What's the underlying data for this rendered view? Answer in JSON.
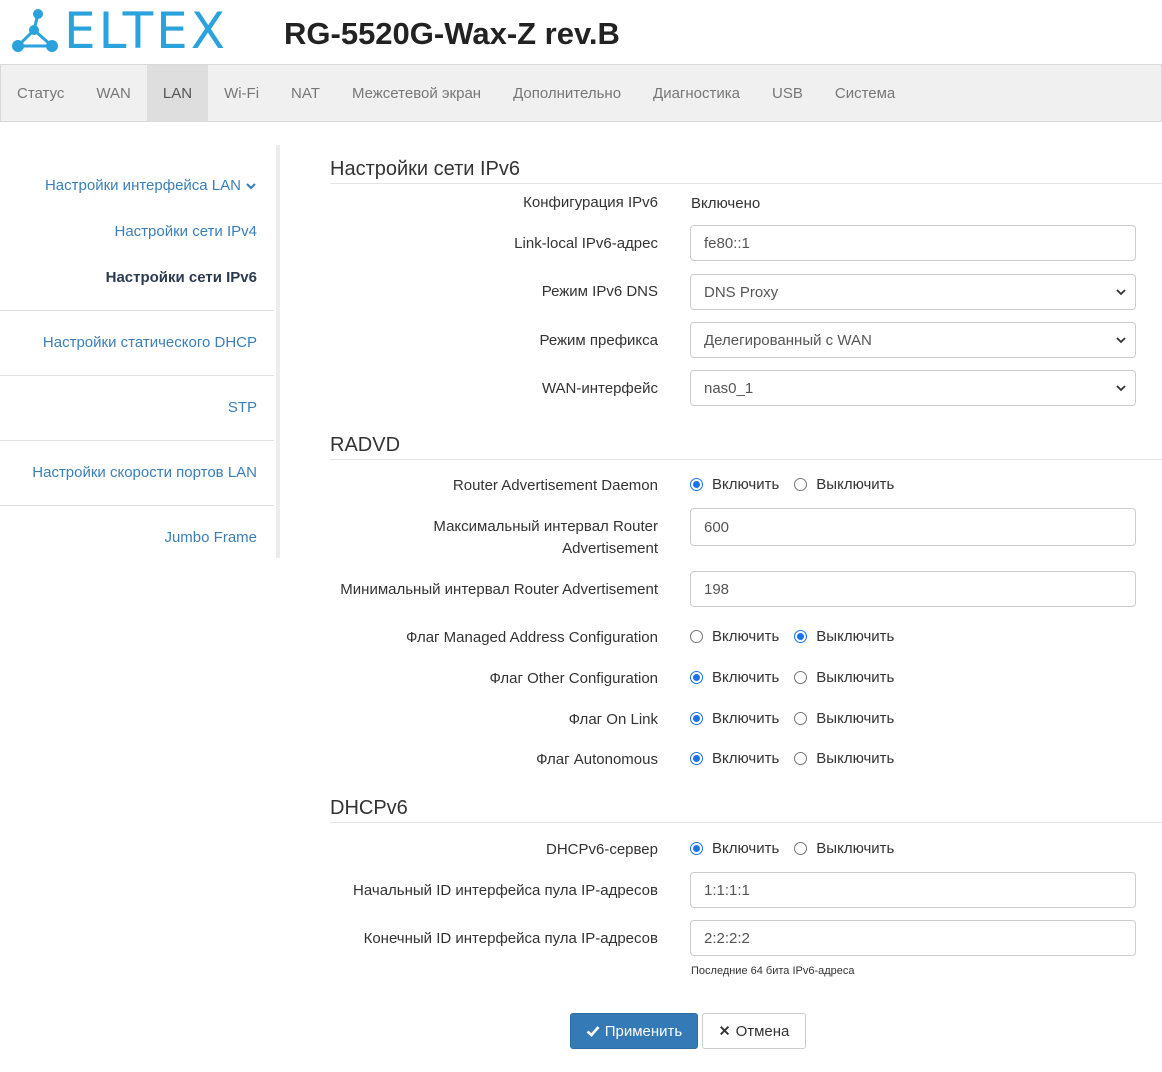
{
  "header": {
    "logo_text": "ELTEX",
    "model": "RG-5520G-Wax-Z rev.B",
    "colors": {
      "logo": "#2aa2dc"
    }
  },
  "topnav": {
    "tabs": [
      {
        "label": "Статус"
      },
      {
        "label": "WAN"
      },
      {
        "label": "LAN",
        "active": true
      },
      {
        "label": "Wi-Fi"
      },
      {
        "label": "NAT"
      },
      {
        "label": "Межсетевой экран"
      },
      {
        "label": "Дополнительно"
      },
      {
        "label": "Диагностика"
      },
      {
        "label": "USB"
      },
      {
        "label": "Система"
      }
    ]
  },
  "sidebar": {
    "items": [
      {
        "label": "Настройки интерфейса LAN",
        "icon": "chevron-down-icon"
      },
      {
        "label": "Настройки сети IPv4"
      },
      {
        "label": "Настройки сети IPv6",
        "active": true
      },
      {
        "label": "Настройки статического DHCP"
      },
      {
        "label": "STP"
      },
      {
        "label": "Настройки скорости портов LAN"
      },
      {
        "label": "Jumbo Frame"
      }
    ]
  },
  "ipv6": {
    "title": "Настройки сети IPv6",
    "config_label": "Конфигурация IPv6",
    "config_value": "Включено",
    "linklocal_label": "Link-local IPv6-адрес",
    "linklocal_value": "fe80::1",
    "dns_label": "Режим IPv6 DNS",
    "dns_value": "DNS Proxy",
    "prefix_label": "Режим префикса",
    "prefix_value": "Делегированный с WAN",
    "wan_label": "WAN-интерфейс",
    "wan_value": "nas0_1"
  },
  "radvd": {
    "title": "RADVD",
    "daemon_label": "Router Advertisement Daemon",
    "max_label_1": "Максимальный интервал Router",
    "max_label_2": "Advertisement",
    "max_value": "600",
    "min_label": "Минимальный интервал Router Advertisement",
    "min_value": "198",
    "managed_label": "Флаг Managed Address Configuration",
    "other_label": "Флаг Other Configuration",
    "onlink_label": "Флаг On Link",
    "autonomous_label": "Флаг Autonomous"
  },
  "dhcpv6": {
    "title": "DHCPv6",
    "server_label": "DHCPv6-сервер",
    "start_label": "Начальный ID интерфейса пула IP-адресов",
    "start_value": "1:1:1:1",
    "end_label": "Конечный ID интерфейса пула IP-адресов",
    "end_value": "2:2:2:2",
    "help": "Последние 64 бита IPv6-адреса"
  },
  "radio": {
    "on": "Включить",
    "off": "Выключить"
  },
  "radio_states": {
    "daemon": "on",
    "managed": "off",
    "other": "on",
    "onlink": "on",
    "autonomous": "on",
    "dhcp_server": "on"
  },
  "buttons": {
    "apply": "Применить",
    "cancel": "Отмена"
  },
  "colors": {
    "accent": "#337ab7",
    "link": "#3b7fb8",
    "radio_checked": "#1a73e8"
  }
}
